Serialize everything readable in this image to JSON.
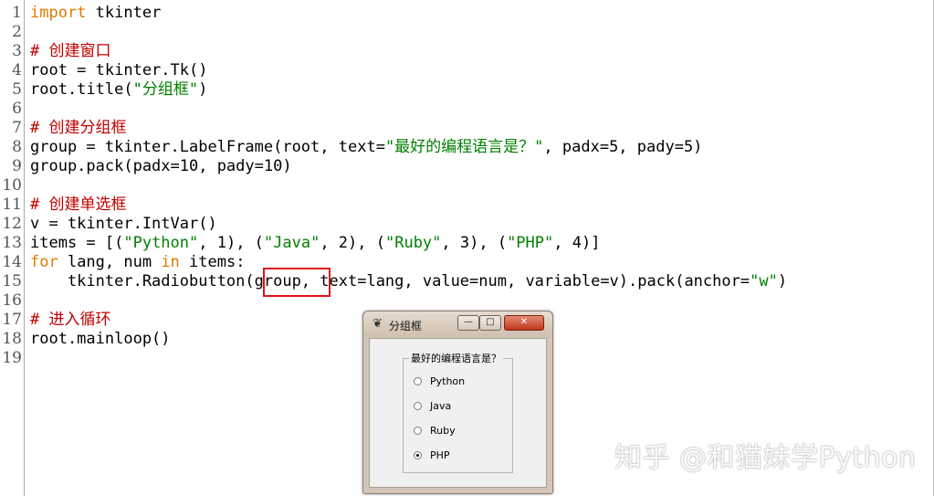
{
  "editor": {
    "line_numbers": [
      "1",
      "2",
      "3",
      "4",
      "5",
      "6",
      "7",
      "8",
      "9",
      "10",
      "11",
      "12",
      "13",
      "14",
      "15",
      "16",
      "17",
      "18",
      "19"
    ],
    "lines": [
      [
        {
          "t": "import",
          "c": "kw"
        },
        {
          "t": " tkinter",
          "c": ""
        }
      ],
      [],
      [
        {
          "t": "# 创建窗口",
          "c": "cm"
        }
      ],
      [
        {
          "t": "root = tkinter.Tk()",
          "c": ""
        }
      ],
      [
        {
          "t": "root.title(",
          "c": ""
        },
        {
          "t": "\"分组框\"",
          "c": "st"
        },
        {
          "t": ")",
          "c": ""
        }
      ],
      [],
      [
        {
          "t": "# 创建分组框",
          "c": "cm"
        }
      ],
      [
        {
          "t": "group = tkinter.LabelFrame(root, text=",
          "c": ""
        },
        {
          "t": "\"最好的编程语言是？\"",
          "c": "st"
        },
        {
          "t": ", padx=5, pady=5)",
          "c": ""
        }
      ],
      [
        {
          "t": "group.pack(padx=10, pady=10)",
          "c": ""
        }
      ],
      [],
      [
        {
          "t": "# 创建单选框",
          "c": "cm"
        }
      ],
      [
        {
          "t": "v = tkinter.IntVar()",
          "c": ""
        }
      ],
      [
        {
          "t": "items = [(",
          "c": ""
        },
        {
          "t": "\"Python\"",
          "c": "st"
        },
        {
          "t": ", 1), (",
          "c": ""
        },
        {
          "t": "\"Java\"",
          "c": "st"
        },
        {
          "t": ", 2), (",
          "c": ""
        },
        {
          "t": "\"Ruby\"",
          "c": "st"
        },
        {
          "t": ", 3), (",
          "c": ""
        },
        {
          "t": "\"PHP\"",
          "c": "st"
        },
        {
          "t": ", 4)]",
          "c": ""
        }
      ],
      [
        {
          "t": "for",
          "c": "kw"
        },
        {
          "t": " lang, num ",
          "c": ""
        },
        {
          "t": "in",
          "c": "kw"
        },
        {
          "t": " items:",
          "c": ""
        }
      ],
      [
        {
          "t": "    tkinter.Radiobutton(group, text=lang, value=num, variable=v).pack(anchor=",
          "c": ""
        },
        {
          "t": "\"w\"",
          "c": "st"
        },
        {
          "t": ")",
          "c": ""
        }
      ],
      [],
      [
        {
          "t": "# 进入循环",
          "c": "cm"
        }
      ],
      [
        {
          "t": "root.mainloop()",
          "c": ""
        }
      ],
      []
    ]
  },
  "colors": {
    "keyword": "#e07a00",
    "comment": "#c00000",
    "string": "#008000",
    "highlight_box": "#e0141e"
  },
  "tk_window": {
    "title": "分组框",
    "icon": "feather-icon",
    "controls": {
      "minimize": "—",
      "maximize": "□",
      "close": "✕"
    },
    "labelframe_text": "最好的编程语言是？",
    "radio_options": [
      {
        "label": "Python",
        "selected": false
      },
      {
        "label": "Java",
        "selected": false
      },
      {
        "label": "Ruby",
        "selected": false
      },
      {
        "label": "PHP",
        "selected": true
      }
    ]
  },
  "watermark": "知乎 @和猫妹学Python"
}
